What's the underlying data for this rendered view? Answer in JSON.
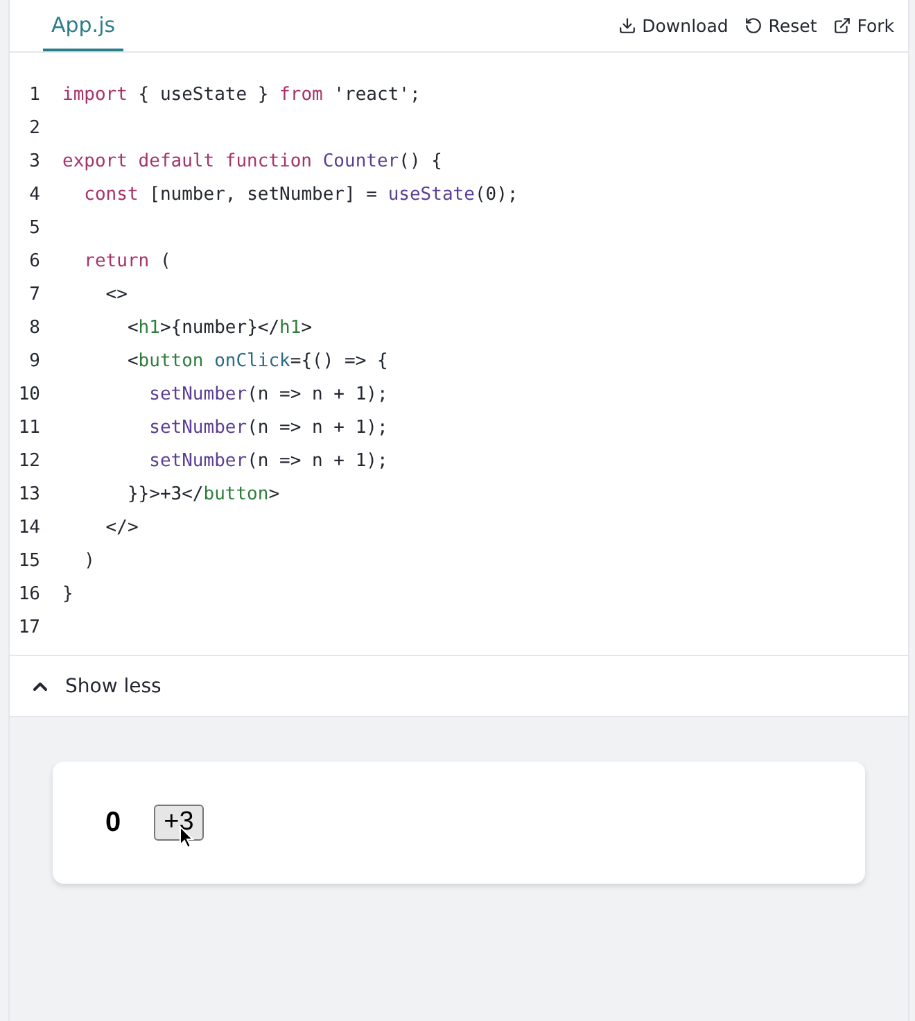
{
  "tabs": [
    {
      "label": "App.js",
      "selected": true
    }
  ],
  "actions": [
    {
      "kind": "download",
      "label": "Download"
    },
    {
      "kind": "reset",
      "label": "Reset"
    },
    {
      "kind": "fork",
      "label": "Fork"
    }
  ],
  "code_lines": [
    {
      "number": "1",
      "tokens": [
        {
          "kind": "keyword",
          "text": "import"
        },
        {
          "kind": "plain",
          "text": " { useState } "
        },
        {
          "kind": "keyword",
          "text": "from"
        },
        {
          "kind": "plain",
          "text": " 'react';"
        }
      ]
    },
    {
      "number": "2"
    },
    {
      "number": "3",
      "tokens": [
        {
          "kind": "keyword",
          "text": "export default function"
        },
        {
          "kind": "fn",
          "text": " Counter"
        },
        {
          "kind": "plain",
          "text": "() {"
        }
      ]
    },
    {
      "number": "4",
      "tokens": [
        {
          "kind": "keyword",
          "text": "  const"
        },
        {
          "kind": "plain",
          "text": " [number, setNumber] = "
        },
        {
          "kind": "fn",
          "text": "useState"
        },
        {
          "kind": "plain",
          "text": "(0);"
        }
      ]
    },
    {
      "number": "5"
    },
    {
      "number": "6",
      "tokens": [
        {
          "kind": "keyword",
          "text": "  return"
        },
        {
          "kind": "plain",
          "text": " ("
        }
      ]
    },
    {
      "number": "7",
      "tokens": [
        {
          "kind": "plain",
          "text": "    <>"
        }
      ]
    },
    {
      "number": "8",
      "tokens": [
        {
          "kind": "plain",
          "text": "      <"
        },
        {
          "kind": "tag",
          "text": "h1"
        },
        {
          "kind": "plain",
          "text": ">{number}</"
        },
        {
          "kind": "tag",
          "text": "h1"
        },
        {
          "kind": "plain",
          "text": ">"
        }
      ]
    },
    {
      "number": "9",
      "tokens": [
        {
          "kind": "plain",
          "text": "      <"
        },
        {
          "kind": "tag",
          "text": "button"
        },
        {
          "kind": "attr",
          "text": " onClick"
        },
        {
          "kind": "plain",
          "text": "={() => {"
        }
      ]
    },
    {
      "number": "10",
      "tokens": [
        {
          "kind": "fn",
          "text": "        setNumber"
        },
        {
          "kind": "plain",
          "text": "(n => n + 1);"
        }
      ]
    },
    {
      "number": "11",
      "tokens": [
        {
          "kind": "fn",
          "text": "        setNumber"
        },
        {
          "kind": "plain",
          "text": "(n => n + 1);"
        }
      ]
    },
    {
      "number": "12",
      "tokens": [
        {
          "kind": "fn",
          "text": "        setNumber"
        },
        {
          "kind": "plain",
          "text": "(n => n + 1);"
        }
      ]
    },
    {
      "number": "13",
      "tokens": [
        {
          "kind": "plain",
          "text": "      }}>+3</"
        },
        {
          "kind": "tag",
          "text": "button"
        },
        {
          "kind": "plain",
          "text": ">"
        }
      ]
    },
    {
      "number": "14",
      "tokens": [
        {
          "kind": "plain",
          "text": "    </>"
        }
      ]
    },
    {
      "number": "15",
      "tokens": [
        {
          "kind": "plain",
          "text": "  )"
        }
      ]
    },
    {
      "number": "16",
      "tokens": [
        {
          "kind": "plain",
          "text": "}"
        }
      ]
    },
    {
      "number": "17"
    }
  ],
  "toggle": {
    "label": "Show less",
    "expanded": true
  },
  "preview": {
    "heading": "0",
    "button": "+3"
  }
}
